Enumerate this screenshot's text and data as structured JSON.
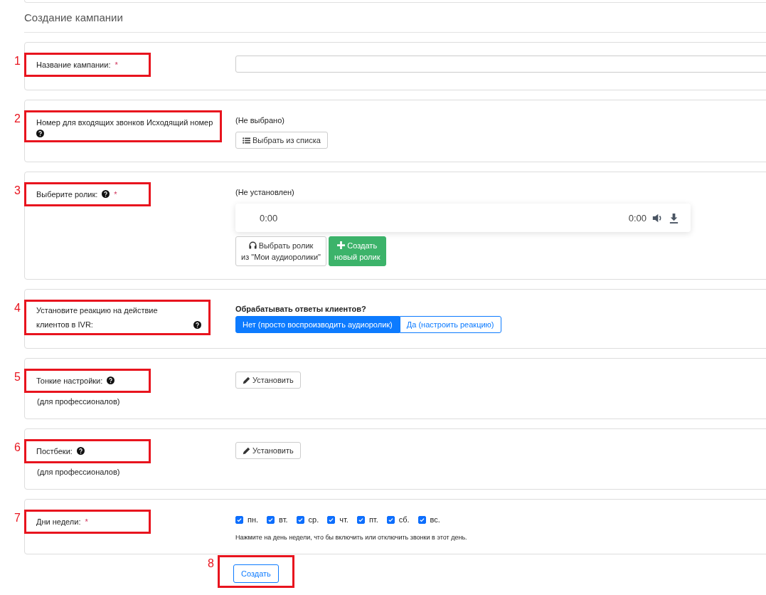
{
  "title": "Создание кампании",
  "sections": [
    {
      "marker": "1",
      "kind": "input",
      "label": "Название кампании:",
      "required_mark": "*",
      "help": false
    },
    {
      "marker": "2",
      "kind": "picker",
      "label": "Номер для входящих звонков Исходящий номер",
      "help": true,
      "status": "(Не выбрано)",
      "button": "Выбрать из списка"
    },
    {
      "marker": "3",
      "kind": "audio",
      "label": "Выберите ролик:",
      "help": true,
      "required_mark": "*",
      "status": "(Не установлен)",
      "player": {
        "current": "0:00",
        "duration": "0:00"
      },
      "buttons": [
        {
          "kind": "choose",
          "lines": [
            "Выбрать ролик",
            "из \"Мои аудиоролики\""
          ]
        },
        {
          "kind": "create",
          "lines": [
            "Создать",
            "новый ролик"
          ]
        }
      ]
    },
    {
      "marker": "4",
      "kind": "toggle",
      "label": "Установите реакцию на действие клиентов в IVR:",
      "help": true,
      "question": "Обрабатывать ответы клиентов?",
      "options": [
        {
          "label": "Нет (просто воспроизводить аудиоролик)",
          "selected": true
        },
        {
          "label": "Да (настроить реакцию)",
          "selected": false
        }
      ]
    },
    {
      "marker": "5",
      "kind": "button",
      "label": "Тонкие настройки:",
      "help": true,
      "sublabel": "(для профессионалов)",
      "button": "Установить"
    },
    {
      "marker": "6",
      "kind": "button",
      "label": "Постбеки:",
      "help": true,
      "sublabel": "(для профессионалов)",
      "button": "Установить"
    },
    {
      "marker": "7",
      "kind": "days",
      "label": "Дни недели:",
      "required_mark": "*",
      "help": false,
      "days": [
        {
          "label": "пн.",
          "checked": true
        },
        {
          "label": "вт.",
          "checked": true
        },
        {
          "label": "ср.",
          "checked": true
        },
        {
          "label": "чт.",
          "checked": true
        },
        {
          "label": "пт.",
          "checked": true
        },
        {
          "label": "сб.",
          "checked": true
        },
        {
          "label": "вс.",
          "checked": true
        }
      ],
      "hint": "Нажмите на день недели, что бы включить или отключить звонки в этот день."
    }
  ],
  "submit": {
    "marker": "8",
    "label": "Создать"
  }
}
